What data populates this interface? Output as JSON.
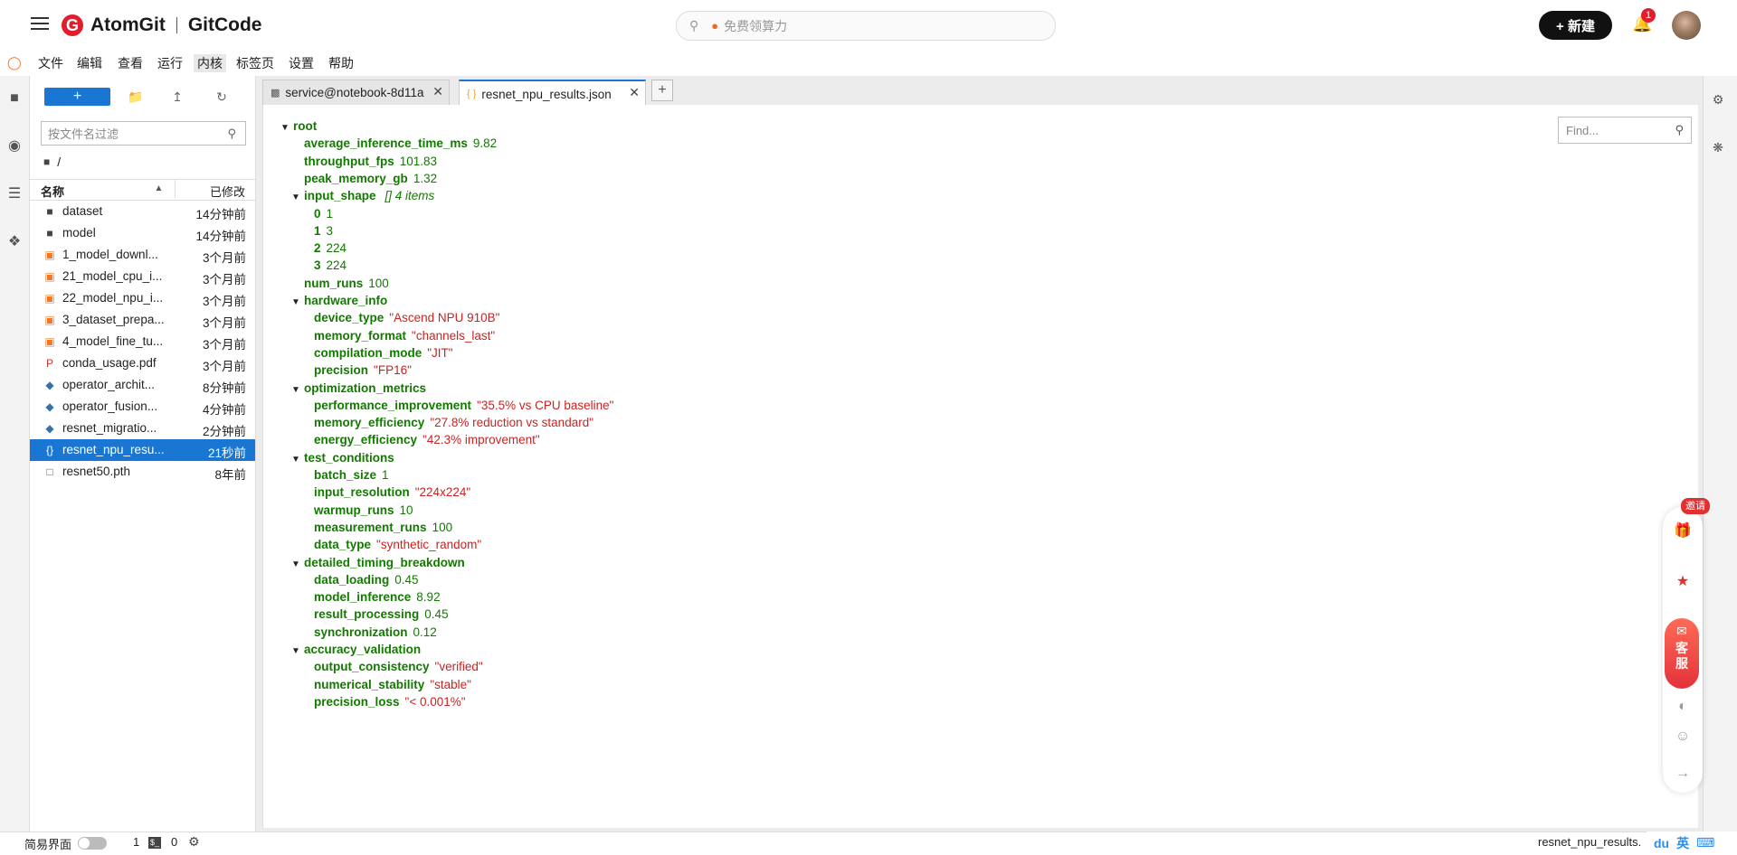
{
  "header": {
    "logo_brand": "AtomGit",
    "logo_product": "GitCode",
    "search_placeholder": "免费领算力",
    "new_button": "+ 新建",
    "notification_count": "1"
  },
  "menubar": {
    "items": [
      "文件",
      "编辑",
      "查看",
      "运行",
      "内核",
      "标签页",
      "设置",
      "帮助"
    ],
    "active_index": 4
  },
  "filebrowser": {
    "new_label": "+",
    "filter_placeholder": "按文件名过滤",
    "breadcrumb": "/",
    "col_name": "名称",
    "col_modified": "已修改",
    "items": [
      {
        "name": "dataset",
        "time": "14分钟前",
        "icon": "folder-icon"
      },
      {
        "name": "model",
        "time": "14分钟前",
        "icon": "folder-icon"
      },
      {
        "name": "1_model_downl...",
        "time": "3个月前",
        "icon": "notebook-icon"
      },
      {
        "name": "21_model_cpu_i...",
        "time": "3个月前",
        "icon": "notebook-icon"
      },
      {
        "name": "22_model_npu_i...",
        "time": "3个月前",
        "icon": "notebook-icon"
      },
      {
        "name": "3_dataset_prepa...",
        "time": "3个月前",
        "icon": "notebook-icon"
      },
      {
        "name": "4_model_fine_tu...",
        "time": "3个月前",
        "icon": "notebook-icon"
      },
      {
        "name": "conda_usage.pdf",
        "time": "3个月前",
        "icon": "pdf-icon"
      },
      {
        "name": "operator_archit...",
        "time": "8分钟前",
        "icon": "python-icon"
      },
      {
        "name": "operator_fusion...",
        "time": "4分钟前",
        "icon": "python-icon"
      },
      {
        "name": "resnet_migratio...",
        "time": "2分钟前",
        "icon": "python-icon"
      },
      {
        "name": "resnet_npu_resu...",
        "time": "21秒前",
        "icon": "json-icon",
        "selected": true
      },
      {
        "name": "resnet50.pth",
        "time": "8年前",
        "icon": "file-icon"
      }
    ]
  },
  "tabs": [
    {
      "label": "service@notebook-8d11a",
      "icon": "terminal-icon",
      "active": false
    },
    {
      "label": "resnet_npu_results.json",
      "icon": "json-icon",
      "active": true
    }
  ],
  "find_placeholder": "Find...",
  "json_tree": [
    {
      "depth": 0,
      "toggle": true,
      "key": "root"
    },
    {
      "depth": 1,
      "key": "average_inference_time_ms",
      "value": "9.82",
      "type": "num"
    },
    {
      "depth": 1,
      "key": "throughput_fps",
      "value": "101.83",
      "type": "num"
    },
    {
      "depth": 1,
      "key": "peak_memory_gb",
      "value": "1.32",
      "type": "num"
    },
    {
      "depth": 1,
      "toggle": true,
      "key": "input_shape",
      "meta": "[] 4 items"
    },
    {
      "depth": 2,
      "key": "0",
      "value": "1",
      "type": "num"
    },
    {
      "depth": 2,
      "key": "1",
      "value": "3",
      "type": "num"
    },
    {
      "depth": 2,
      "key": "2",
      "value": "224",
      "type": "num"
    },
    {
      "depth": 2,
      "key": "3",
      "value": "224",
      "type": "num"
    },
    {
      "depth": 1,
      "key": "num_runs",
      "value": "100",
      "type": "num"
    },
    {
      "depth": 1,
      "toggle": true,
      "key": "hardware_info"
    },
    {
      "depth": 2,
      "key": "device_type",
      "value": "\"Ascend NPU 910B\"",
      "type": "str"
    },
    {
      "depth": 2,
      "key": "memory_format",
      "value": "\"channels_last\"",
      "type": "str"
    },
    {
      "depth": 2,
      "key": "compilation_mode",
      "value": "\"JIT\"",
      "type": "str"
    },
    {
      "depth": 2,
      "key": "precision",
      "value": "\"FP16\"",
      "type": "str"
    },
    {
      "depth": 1,
      "toggle": true,
      "key": "optimization_metrics"
    },
    {
      "depth": 2,
      "key": "performance_improvement",
      "value": "\"35.5% vs CPU baseline\"",
      "type": "str"
    },
    {
      "depth": 2,
      "key": "memory_efficiency",
      "value": "\"27.8% reduction vs standard\"",
      "type": "str"
    },
    {
      "depth": 2,
      "key": "energy_efficiency",
      "value": "\"42.3% improvement\"",
      "type": "str"
    },
    {
      "depth": 1,
      "toggle": true,
      "key": "test_conditions"
    },
    {
      "depth": 2,
      "key": "batch_size",
      "value": "1",
      "type": "num"
    },
    {
      "depth": 2,
      "key": "input_resolution",
      "value": "\"224x224\"",
      "type": "str"
    },
    {
      "depth": 2,
      "key": "warmup_runs",
      "value": "10",
      "type": "num"
    },
    {
      "depth": 2,
      "key": "measurement_runs",
      "value": "100",
      "type": "num"
    },
    {
      "depth": 2,
      "key": "data_type",
      "value": "\"synthetic_random\"",
      "type": "str"
    },
    {
      "depth": 1,
      "toggle": true,
      "key": "detailed_timing_breakdown"
    },
    {
      "depth": 2,
      "key": "data_loading",
      "value": "0.45",
      "type": "num"
    },
    {
      "depth": 2,
      "key": "model_inference",
      "value": "8.92",
      "type": "num"
    },
    {
      "depth": 2,
      "key": "result_processing",
      "value": "0.45",
      "type": "num"
    },
    {
      "depth": 2,
      "key": "synchronization",
      "value": "0.12",
      "type": "num"
    },
    {
      "depth": 1,
      "toggle": true,
      "key": "accuracy_validation"
    },
    {
      "depth": 2,
      "key": "output_consistency",
      "value": "\"verified\"",
      "type": "str"
    },
    {
      "depth": 2,
      "key": "numerical_stability",
      "value": "\"stable\"",
      "type": "str"
    },
    {
      "depth": 2,
      "key": "precision_loss",
      "value": "\"< 0.001%\"",
      "type": "str"
    }
  ],
  "floating": {
    "invite": "邀请",
    "service": "客服"
  },
  "statusbar": {
    "simple_mode": "简易界面",
    "kernel_count": "1",
    "terminal_count": "0",
    "filename": "resnet_npu_results.",
    "ime": "英"
  }
}
